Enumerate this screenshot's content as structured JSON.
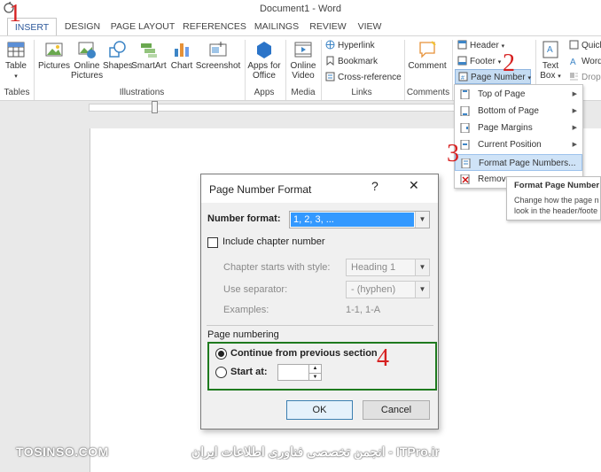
{
  "window": {
    "title": "Document1 - Word"
  },
  "tabs": [
    {
      "label": "INSERT",
      "active": true
    },
    {
      "label": "DESIGN"
    },
    {
      "label": "PAGE LAYOUT"
    },
    {
      "label": "REFERENCES"
    },
    {
      "label": "MAILINGS"
    },
    {
      "label": "REVIEW"
    },
    {
      "label": "VIEW"
    }
  ],
  "ribbon": {
    "table": "Table",
    "pictures": "Pictures",
    "online_pictures_1": "Online",
    "online_pictures_2": "Pictures",
    "shapes": "Shapes",
    "smartart": "SmartArt",
    "chart": "Chart",
    "screenshot": "Screenshot",
    "apps_1": "Apps for",
    "apps_2": "Office",
    "online_video_1": "Online",
    "online_video_2": "Video",
    "hyperlink": "Hyperlink",
    "bookmark": "Bookmark",
    "cross_reference": "Cross-reference",
    "comment": "Comment",
    "header": "Header",
    "footer": "Footer",
    "page_number": "Page Number",
    "text_box_1": "Text",
    "text_box_2": "Box",
    "quick": "Quick",
    "word": "Word",
    "drop": "Drop",
    "groups": {
      "tables": "Tables",
      "illustrations": "Illustrations",
      "apps": "Apps",
      "media": "Media",
      "links": "Links",
      "comments": "Comments"
    }
  },
  "menu": {
    "items": [
      "Top of Page",
      "Bottom of Page",
      "Page Margins",
      "Current Position",
      "Format Page Numbers...",
      "Remove"
    ]
  },
  "tooltip": {
    "title": "Format Page Number",
    "line1": "Change how the page n",
    "line2": "look in the header/foote"
  },
  "dialog": {
    "title": "Page Number Format",
    "help": "?",
    "close": "✕",
    "number_format_label": "Number format:",
    "number_format_value": "1, 2, 3, ...",
    "include_chapter": "Include chapter number",
    "chapter_starts_label": "Chapter starts with style:",
    "chapter_starts_value": "Heading 1",
    "separator_label": "Use separator:",
    "separator_value": "-   (hyphen)",
    "examples_label": "Examples:",
    "examples_value": "1-1, 1-A",
    "page_numbering": "Page numbering",
    "continue_label": "Continue from previous section",
    "start_at_label": "Start at:",
    "start_at_value": "",
    "ok": "OK",
    "cancel": "Cancel"
  },
  "steps": [
    "1",
    "2",
    "3",
    "4"
  ],
  "watermark": {
    "left": "TOSINSO.COM",
    "right": "ITPro.ir - انجمن تخصصی فناوری اطلاعات ایران"
  },
  "colors": {
    "accent": "#2b579a",
    "step_red": "#d62020",
    "highlight_green": "#1e7a1e",
    "selection_blue": "#3399ff"
  }
}
